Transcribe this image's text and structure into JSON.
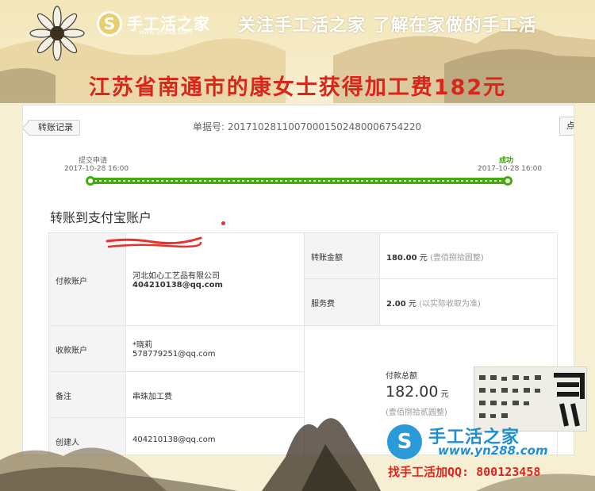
{
  "banner": {
    "site_name": "手工活之家",
    "site_url": "www.yn288.com",
    "slogan": "关注手工活之家 了解在家做的手工活",
    "headline": "江苏省南通市的康女士获得加工费182元"
  },
  "transfer": {
    "back_label": "转账记录",
    "receipt_label": "单据号:",
    "receipt_no": "20171028110070001502480006754220",
    "print_label": "点",
    "steps": [
      {
        "label": "提交申请",
        "time": "2017-10-28 16:00"
      },
      {
        "label": "成功",
        "time": "2017-10-28 16:00"
      }
    ],
    "progress": 1.0,
    "section_title": "转账到支付宝账户",
    "payer_label": "付款账户",
    "payer_company": "河北如心工艺品有限公司",
    "payer_email": "404210138@qq.com",
    "payee_label": "收款账户",
    "payee_name": "*晓莉",
    "payee_account": "578779251@qq.com",
    "note_label": "备注",
    "note_value": "串珠加工费",
    "creator_label": "创建人",
    "creator_value": "404210138@qq.com",
    "amount_label": "转账金额",
    "amount_value": "180.00",
    "amount_unit": "元",
    "amount_words": "(壹佰捌拾圆整)",
    "fee_label": "服务费",
    "fee_value": "2.00",
    "fee_unit": "元",
    "fee_note": "(以实际收取为准)",
    "total_label": "付款总额",
    "total_value": "182.00",
    "total_unit": "元",
    "total_words": "(壹佰捌拾贰圆整)"
  },
  "footer": {
    "site_name": "手工活之家",
    "site_url": "www.yn288.com",
    "contact": "找手工活加QQ: 800123458"
  },
  "colors": {
    "headline": "#d8261a",
    "progress": "#43ad0f",
    "brand_blue": "#1f8fd4",
    "background": "#f7efd3"
  }
}
